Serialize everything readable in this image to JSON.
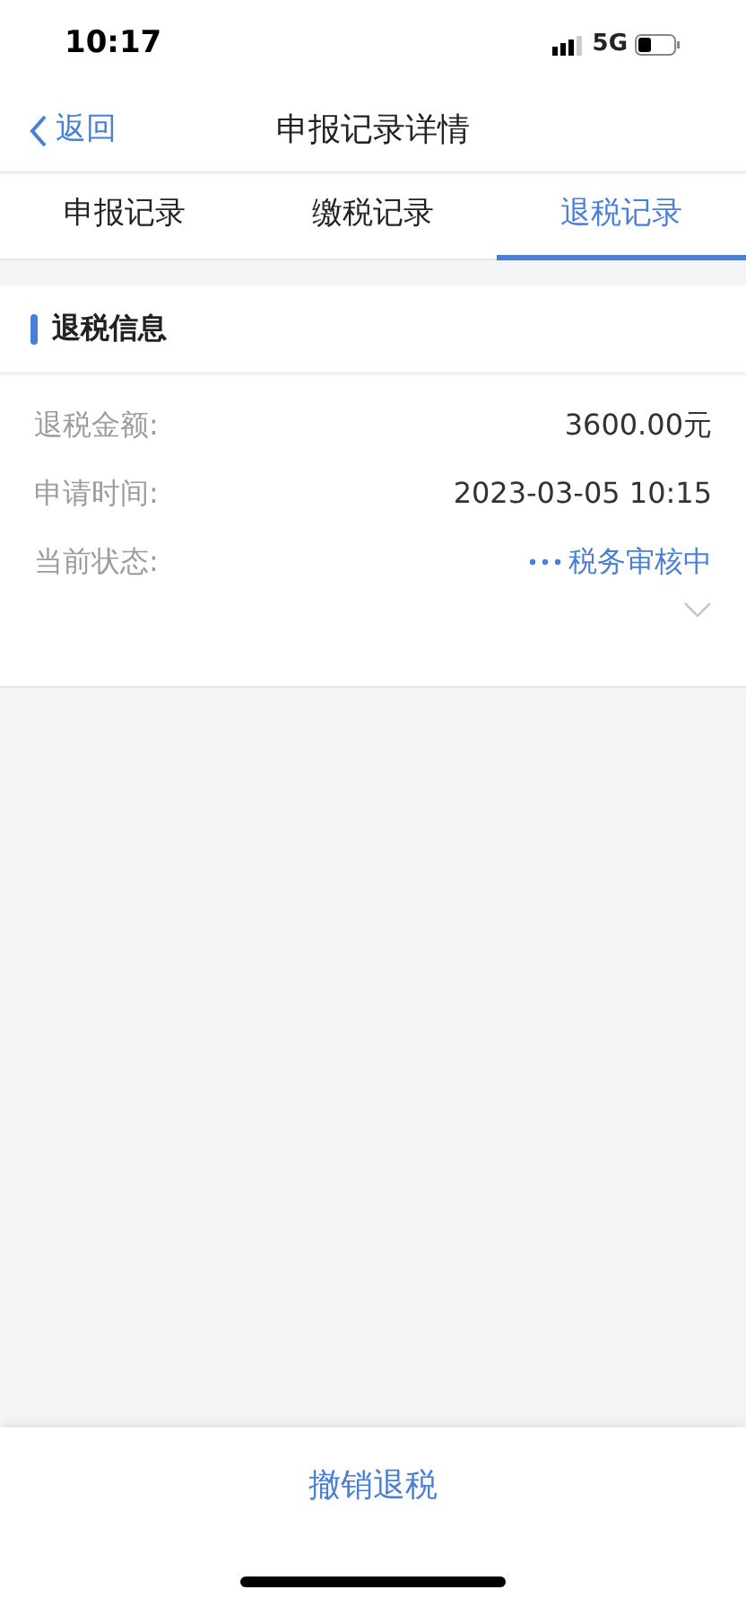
{
  "status_bar": {
    "time": "10:17",
    "network": "5G"
  },
  "nav": {
    "back": "返回",
    "title": "申报记录详情"
  },
  "tabs": [
    {
      "label": "申报记录",
      "selected": false
    },
    {
      "label": "缴税记录",
      "selected": false
    },
    {
      "label": "退税记录",
      "selected": true
    }
  ],
  "section": {
    "title": "退税信息",
    "rows": [
      {
        "label": "退税金额:",
        "value": "3600.00元",
        "kind": "plain"
      },
      {
        "label": "申请时间:",
        "value": "2023-03-05 10:15",
        "kind": "plain"
      },
      {
        "label": "当前状态:",
        "value": "税务审核中",
        "kind": "status",
        "expanded": false
      }
    ]
  },
  "action": {
    "label": "撤销退税"
  }
}
